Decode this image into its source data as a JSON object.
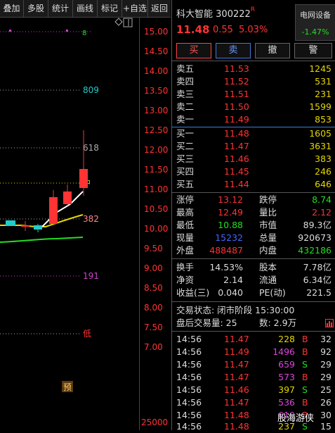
{
  "toolbar": {
    "items": [
      "叠加",
      "多股",
      "统计",
      "画线",
      "标记",
      "+自选",
      "返回"
    ]
  },
  "chart": {
    "price_axis": [
      "15.00",
      "14.50",
      "14.00",
      "13.50",
      "13.00",
      "12.50",
      "12.00",
      "11.50",
      "11.00",
      "10.50",
      "10.00",
      "9.50",
      "9.00",
      "8.50",
      "8.00",
      "7.50",
      "7.00"
    ],
    "volume_axis": "25000",
    "level_labels": {
      "l809": "809",
      "l618": "618",
      "l_zhong": "中",
      "l382": "382",
      "l191": "191",
      "l_di": "低"
    },
    "marker_yu": "预",
    "top_marker": "8"
  },
  "stock": {
    "name": "科大智能",
    "code": "300222",
    "flag": "R",
    "price": "11.48",
    "change": "0.55",
    "change_pct": "5.03%",
    "sector_name": "电网设备",
    "sector_pct": "-1.47%"
  },
  "actions": [
    "买",
    "卖",
    "撤",
    "警"
  ],
  "order_book": {
    "asks": [
      {
        "label": "卖五",
        "price": "11.53",
        "volume": "1245"
      },
      {
        "label": "卖四",
        "price": "11.52",
        "volume": "531"
      },
      {
        "label": "卖三",
        "price": "11.51",
        "volume": "231"
      },
      {
        "label": "卖二",
        "price": "11.50",
        "volume": "1599"
      },
      {
        "label": "卖一",
        "price": "11.49",
        "volume": "853"
      }
    ],
    "bids": [
      {
        "label": "买一",
        "price": "11.48",
        "volume": "1605"
      },
      {
        "label": "买二",
        "price": "11.47",
        "volume": "3631"
      },
      {
        "label": "买三",
        "price": "11.46",
        "volume": "383"
      },
      {
        "label": "买四",
        "price": "11.45",
        "volume": "246"
      },
      {
        "label": "买五",
        "price": "11.44",
        "volume": "646"
      }
    ]
  },
  "stats": {
    "zhangting_label": "涨停",
    "zhangting": "13.12",
    "dieting_label": "跌停",
    "dieting": "8.74",
    "zuigao_label": "最高",
    "zuigao": "12.49",
    "liangbi_label": "量比",
    "liangbi": "2.12",
    "zuidi_label": "最低",
    "zuidi": "10.88",
    "shizhi_label": "市值",
    "shizhi": "89.3亿",
    "xianliang_label": "现量",
    "xianliang": "15232",
    "zongliang_label": "总量",
    "zongliang": "920673",
    "waipan_label": "外盘",
    "waipan": "488487",
    "neipan_label": "内盘",
    "neipan": "432186",
    "huanshou_label": "换手",
    "huanshou": "14.53%",
    "guben_label": "股本",
    "guben": "7.78亿",
    "jingzi_label": "净资",
    "jingzi": "2.14",
    "liutong_label": "流通",
    "liutong": "6.34亿",
    "shouyi_label": "收益(三)",
    "shouyi": "0.040",
    "pe_label": "PE(动)",
    "pe": "221.5"
  },
  "status": {
    "line1": "交易状态: 闭市阶段 15:30:00",
    "line2_label": "盘后交易量: 25",
    "line2_count": "数: 2.9万"
  },
  "trades": [
    {
      "time": "14:56",
      "price": "11.47",
      "vol": "228",
      "side": "B",
      "num": "32"
    },
    {
      "time": "14:56",
      "price": "11.49",
      "vol": "1496",
      "side": "B",
      "num": "92"
    },
    {
      "time": "14:56",
      "price": "11.47",
      "vol": "659",
      "side": "S",
      "num": "29"
    },
    {
      "time": "14:56",
      "price": "11.47",
      "vol": "573",
      "side": "B",
      "num": "29"
    },
    {
      "time": "14:56",
      "price": "11.46",
      "vol": "397",
      "side": "S",
      "num": "25"
    },
    {
      "time": "14:56",
      "price": "11.47",
      "vol": "536",
      "side": "B",
      "num": "26"
    },
    {
      "time": "14:56",
      "price": "11.48",
      "vol": "619",
      "side": "B",
      "num": "30"
    },
    {
      "time": "14:56",
      "price": "11.48",
      "vol": "237",
      "side": "S",
      "num": "15"
    }
  ],
  "watermark": "股海游侠",
  "colors": {
    "up": "#ff3333",
    "down": "#22dd22",
    "volume": "#e6d700",
    "buy_count": "#dd44dd",
    "accent_blue": "#3a7bd5"
  }
}
